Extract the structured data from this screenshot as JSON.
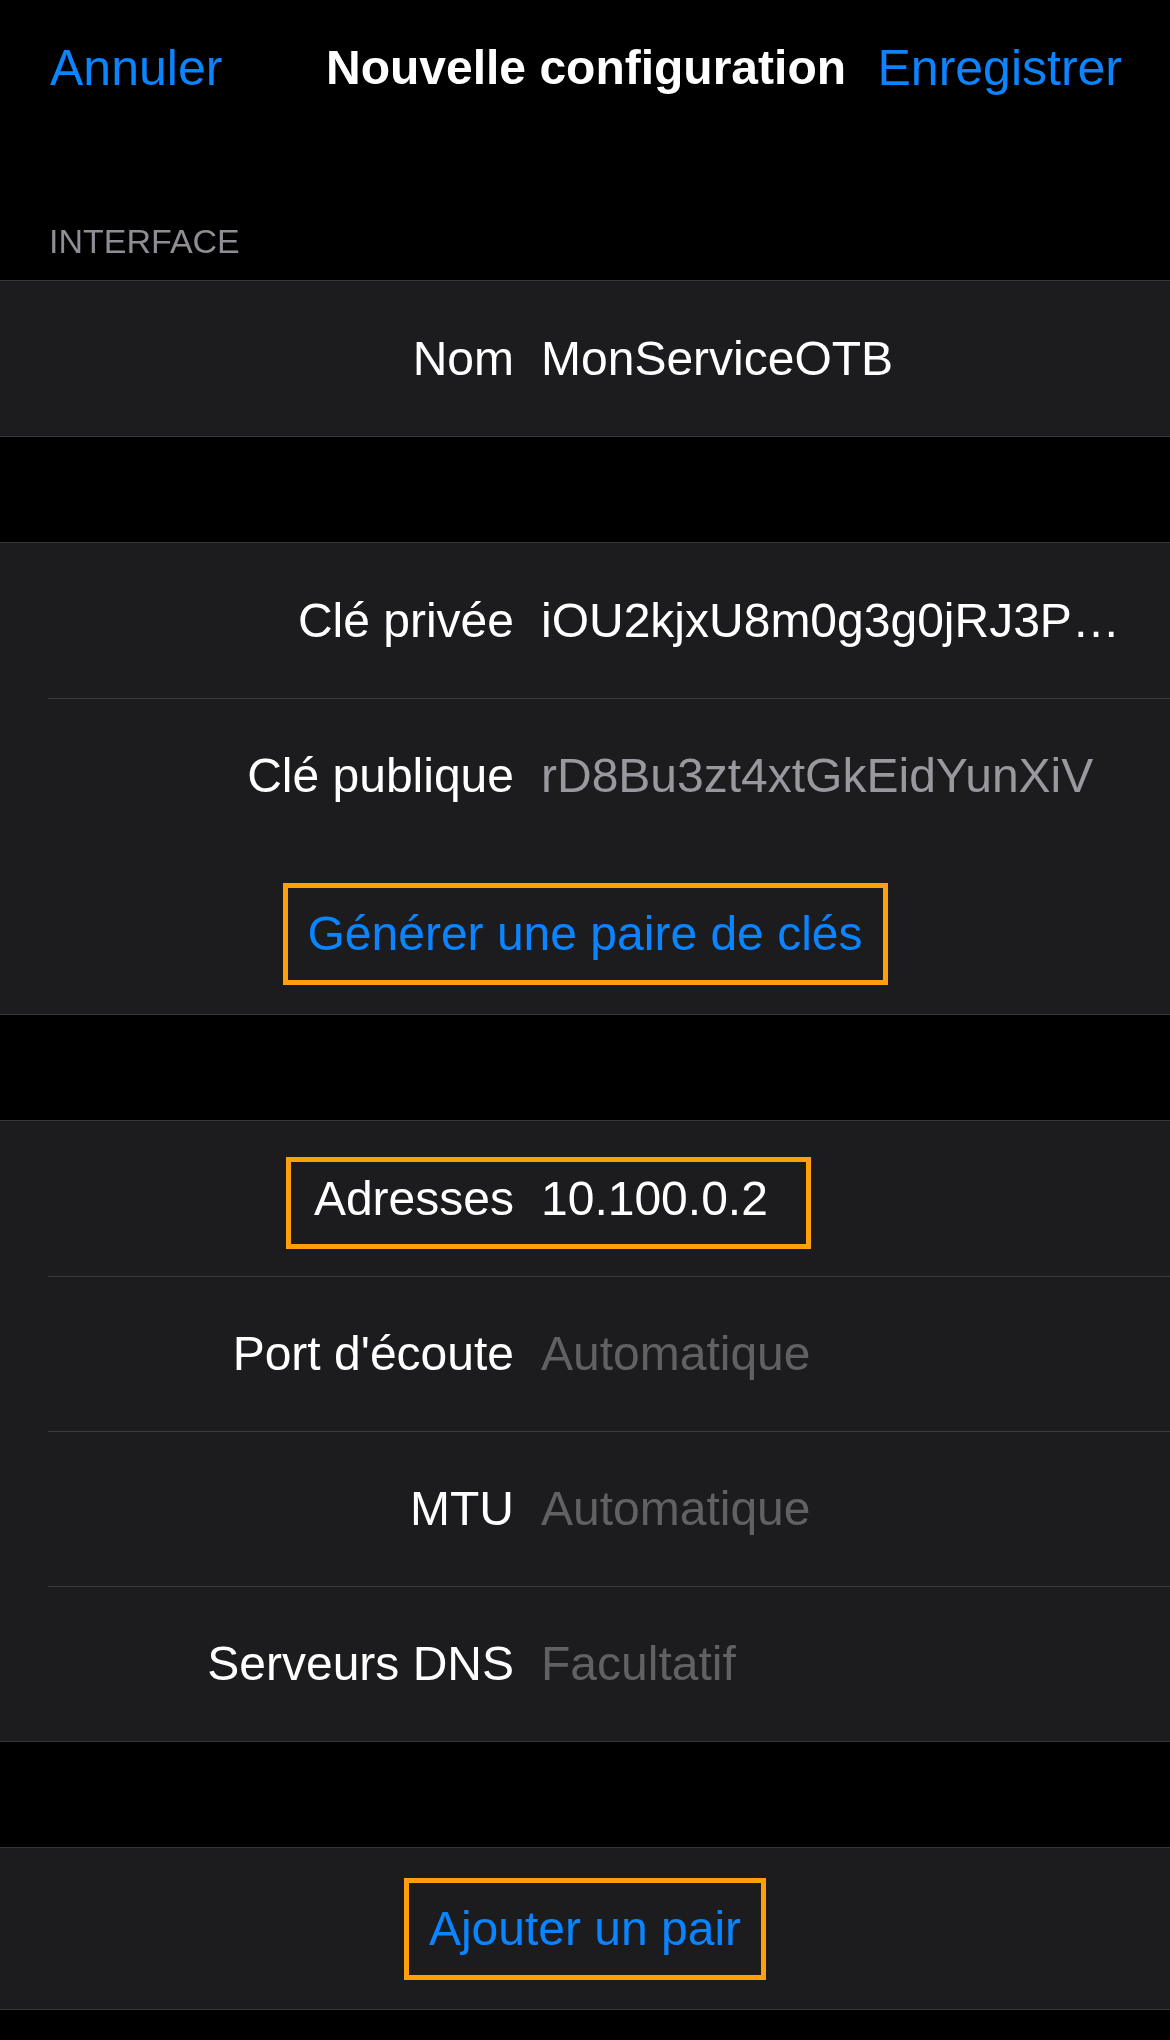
{
  "nav": {
    "cancel": "Annuler",
    "title": "Nouvelle configuration",
    "save": "Enregistrer"
  },
  "sections": [
    {
      "header": "INTERFACE",
      "rows": [
        {
          "kind": "field",
          "label": "Nom",
          "value": "MonServiceOTB",
          "highlighted": false
        }
      ]
    },
    {
      "rows": [
        {
          "kind": "field",
          "label": "Clé privée",
          "value": "iOU2kjxU8m0g3g0jRJ3P…",
          "highlighted": false
        },
        {
          "kind": "text",
          "label": "Clé publique",
          "value": "rD8Bu3zt4xtGkEidYunXiV",
          "highlighted": false
        },
        {
          "kind": "action",
          "label": "Générer une paire de clés",
          "highlighted": true
        }
      ]
    },
    {
      "rows": [
        {
          "kind": "field",
          "label": "Adresses",
          "value": "10.100.0.2",
          "highlighted": true
        },
        {
          "kind": "field",
          "label": "Port d'écoute",
          "placeholder": "Automatique",
          "highlighted": false
        },
        {
          "kind": "field",
          "label": "MTU",
          "placeholder": "Automatique",
          "highlighted": false
        },
        {
          "kind": "field",
          "label": "Serveurs DNS",
          "placeholder": "Facultatif",
          "highlighted": false
        }
      ]
    },
    {
      "rows": [
        {
          "kind": "action",
          "label": "Ajouter un pair",
          "highlighted": true
        }
      ]
    }
  ]
}
